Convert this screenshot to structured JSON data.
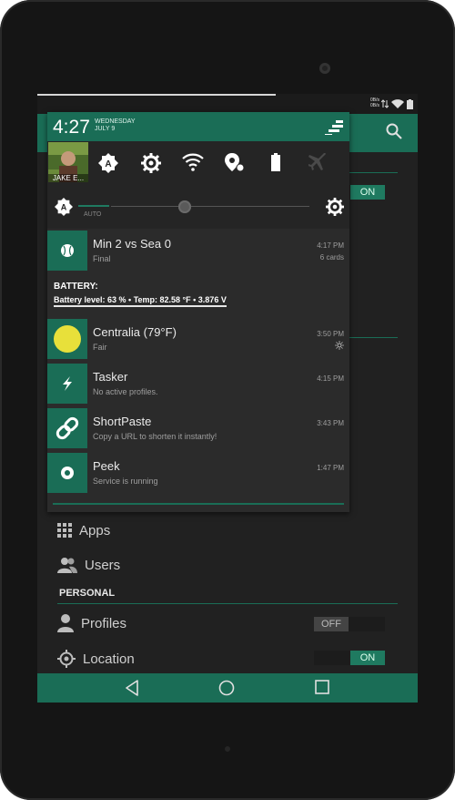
{
  "status_bar": {
    "net_line1": "0B/s",
    "net_line2": "0B/s"
  },
  "shade": {
    "clock": "4:27",
    "weekday": "WEDNESDAY",
    "date": "JULY 9",
    "user_name": "JAKE E...",
    "auto_label": "AUTO",
    "quick_settings": [
      "auto-rotate",
      "settings",
      "wifi",
      "location",
      "battery",
      "airplane-mode"
    ]
  },
  "notifications": [
    {
      "title": "Min 2 vs Sea 0",
      "subtitle": "Final",
      "time": "4:17 PM",
      "extra": "6 cards",
      "icon": "baseball-icon"
    },
    {
      "title": "Centralia (79°F)",
      "subtitle": "Fair",
      "time": "3:50 PM",
      "extra": "",
      "icon": "sun-icon"
    },
    {
      "title": "Tasker",
      "subtitle": "No active profiles.",
      "time": "4:15 PM",
      "extra": "",
      "icon": "lightning-icon"
    },
    {
      "title": "ShortPaste",
      "subtitle": "Copy a URL to shorten it instantly!",
      "time": "3:43 PM",
      "extra": "",
      "icon": "link-icon"
    },
    {
      "title": "Peek",
      "subtitle": "Service is running",
      "time": "1:47 PM",
      "extra": "",
      "icon": "peek-icon"
    }
  ],
  "battery": {
    "title": "BATTERY:",
    "line": "Battery level: 63 %  •  Temp: 82.58 °F  •  3.876 V"
  },
  "background_app": {
    "toggle_top": "ON",
    "items": [
      {
        "label": "Apps",
        "icon": "apps-grid-icon"
      },
      {
        "label": "Users",
        "icon": "users-icon"
      }
    ],
    "personal_header": "PERSONAL",
    "profiles": {
      "label": "Profiles",
      "toggle": "OFF"
    },
    "location": {
      "label": "Location",
      "toggle": "ON"
    }
  },
  "colors": {
    "accent": "#1a6d56",
    "shade_bg": "#2b2b2b",
    "background": "#212121"
  }
}
